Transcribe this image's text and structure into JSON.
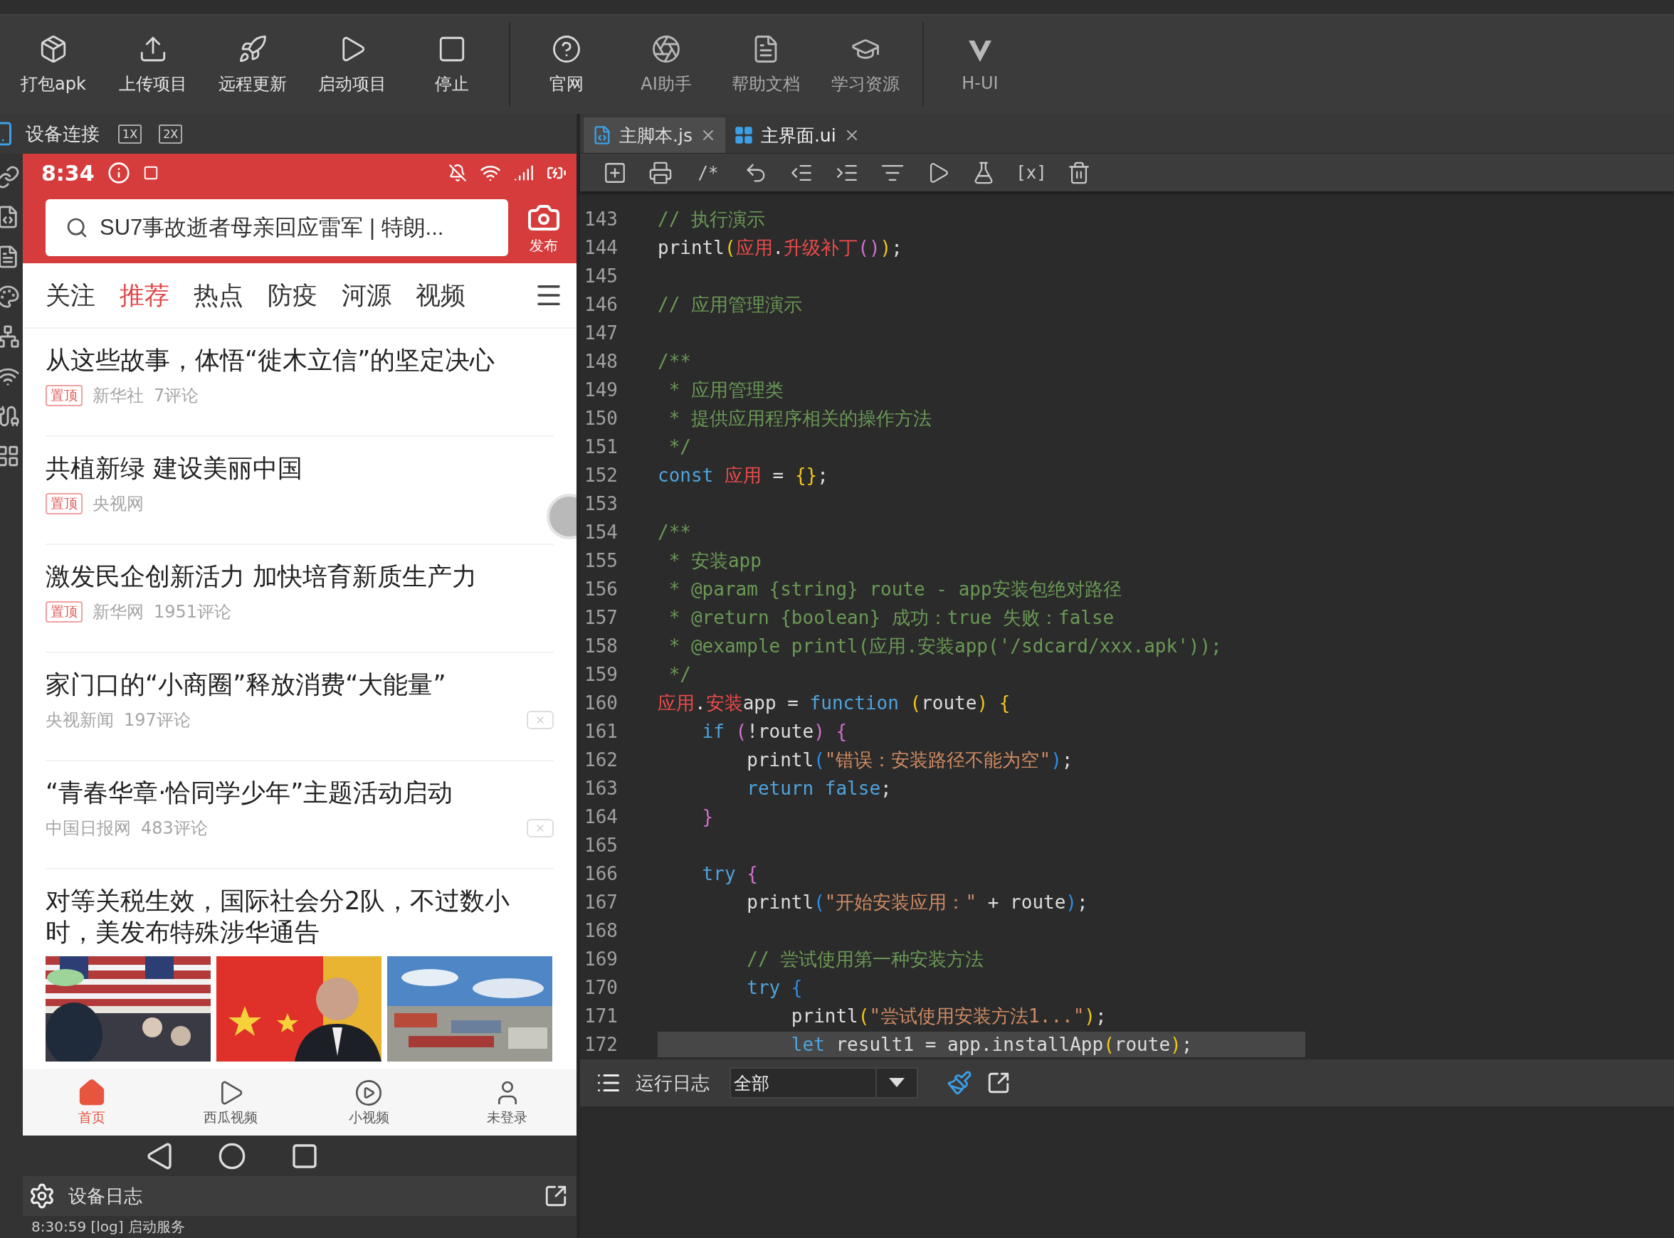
{
  "toolbar": {
    "groups": [
      {
        "items": [
          {
            "label": "打包apk",
            "disabled": false
          },
          {
            "label": "上传项目",
            "disabled": false
          },
          {
            "label": "远程更新",
            "disabled": false
          },
          {
            "label": "启动项目",
            "disabled": false
          },
          {
            "label": "停止",
            "disabled": false
          }
        ]
      },
      {
        "items": [
          {
            "label": "官网",
            "disabled": false
          },
          {
            "label": "AI助手",
            "disabled": true
          },
          {
            "label": "帮助文档",
            "disabled": true
          },
          {
            "label": "学习资源",
            "disabled": true
          }
        ]
      },
      {
        "items": [
          {
            "label": "H-UI",
            "disabled": true
          }
        ]
      }
    ]
  },
  "device_panel": {
    "title": "设备连接",
    "zoom_buttons": [
      "1X",
      "2X"
    ]
  },
  "phone": {
    "status_bar": {
      "time": "8:34"
    },
    "search": {
      "placeholder": "SU7事故逝者母亲回应雷军 | 特朗..."
    },
    "publish_label": "发布",
    "tabs": [
      {
        "label": "关注",
        "selected": false
      },
      {
        "label": "推荐",
        "selected": true
      },
      {
        "label": "热点",
        "selected": false
      },
      {
        "label": "防疫",
        "selected": false
      },
      {
        "label": "河源",
        "selected": false
      },
      {
        "label": "视频",
        "selected": false
      }
    ],
    "news": [
      {
        "title": "从这些故事，体悟“徙木立信”的坚定决心",
        "tag": "置顶",
        "source": "新华社",
        "comments": "7评论",
        "dismissible": false
      },
      {
        "title": "共植新绿 建设美丽中国",
        "tag": "置顶",
        "source": "央视网",
        "dismissible": false
      },
      {
        "title": "激发民企创新活力 加快培育新质生产力",
        "tag": "置顶",
        "source": "新华网",
        "comments": "1951评论",
        "dismissible": false
      },
      {
        "title": "家门口的“小商圈”释放消费“大能量”",
        "source": "央视新闻",
        "comments": "197评论",
        "dismissible": true
      },
      {
        "title": "“青春华章·恰同学少年”主题活动启动",
        "source": "中国日报网",
        "comments": "483评论",
        "dismissible": true
      },
      {
        "title": "对等关税生效，国际社会分2队，不过数小时，美发布特殊涉华通告",
        "dismissible": false
      }
    ],
    "bottom_nav": [
      {
        "label": "首页",
        "selected": true
      },
      {
        "label": "西瓜视频",
        "selected": false
      },
      {
        "label": "小视频",
        "selected": false
      },
      {
        "label": "未登录",
        "selected": false
      }
    ]
  },
  "device_log": {
    "title": "设备日志",
    "lines": [
      "8:30:59 [log] 启动服务"
    ]
  },
  "editor": {
    "tabs": [
      {
        "label": "主脚本.js",
        "kind": "js",
        "selected": true
      },
      {
        "label": "主界面.ui",
        "kind": "ui",
        "selected": false
      }
    ],
    "toolbar": [
      {
        "kind": "add"
      },
      {
        "kind": "print"
      },
      {
        "kind": "glyph",
        "text": "/*"
      },
      {
        "kind": "undo"
      },
      {
        "kind": "outdent"
      },
      {
        "kind": "indent"
      },
      {
        "kind": "format"
      },
      {
        "kind": "run"
      },
      {
        "kind": "test"
      },
      {
        "kind": "glyph",
        "text": "[x]"
      },
      {
        "kind": "clear"
      }
    ],
    "lines": [
      {
        "number": "143",
        "current": false,
        "tokens": [
          {
            "kind": "comment",
            "text": "// 执行演示"
          }
        ]
      },
      {
        "number": "144",
        "current": false,
        "tokens": [
          {
            "kind": "plain",
            "text": "printl"
          },
          {
            "kind": "paren1",
            "text": "("
          },
          {
            "kind": "ident",
            "text": "应用"
          },
          {
            "kind": "plain",
            "text": "."
          },
          {
            "kind": "ident",
            "text": "升级补丁"
          },
          {
            "kind": "paren2",
            "text": "()"
          },
          {
            "kind": "paren1",
            "text": ")"
          },
          {
            "kind": "plain",
            "text": ";"
          }
        ]
      },
      {
        "number": "145",
        "current": false
      },
      {
        "number": "146",
        "current": false,
        "tokens": [
          {
            "kind": "comment",
            "text": "// 应用管理演示"
          }
        ]
      },
      {
        "number": "147",
        "current": false
      },
      {
        "number": "148",
        "current": false,
        "tokens": [
          {
            "kind": "comment",
            "text": "/**"
          }
        ]
      },
      {
        "number": "149",
        "current": false,
        "tokens": [
          {
            "kind": "comment",
            "text": " * 应用管理类"
          }
        ]
      },
      {
        "number": "150",
        "current": false,
        "tokens": [
          {
            "kind": "comment",
            "text": " * 提供应用程序相关的操作方法"
          }
        ]
      },
      {
        "number": "151",
        "current": false,
        "tokens": [
          {
            "kind": "comment",
            "text": " */"
          }
        ]
      },
      {
        "number": "152",
        "current": false,
        "tokens": [
          {
            "kind": "keyword",
            "text": "const"
          },
          {
            "kind": "ident",
            "text": " 应用"
          },
          {
            "kind": "plain",
            "text": " = "
          },
          {
            "kind": "paren1",
            "text": "{}"
          },
          {
            "kind": "plain",
            "text": ";"
          }
        ]
      },
      {
        "number": "153",
        "current": false
      },
      {
        "number": "154",
        "current": false,
        "tokens": [
          {
            "kind": "comment",
            "text": "/**"
          }
        ]
      },
      {
        "number": "155",
        "current": false,
        "tokens": [
          {
            "kind": "comment",
            "text": " * 安装app"
          }
        ]
      },
      {
        "number": "156",
        "current": false,
        "tokens": [
          {
            "kind": "comment",
            "text": " * @param {string} route - app安装包绝对路径"
          }
        ]
      },
      {
        "number": "157",
        "current": false,
        "tokens": [
          {
            "kind": "comment",
            "text": " * @return {boolean} 成功：true 失败：false"
          }
        ]
      },
      {
        "number": "158",
        "current": false,
        "tokens": [
          {
            "kind": "comment",
            "text": " * @example printl(应用.安装app('/sdcard/xxx.apk'));"
          }
        ]
      },
      {
        "number": "159",
        "current": false,
        "tokens": [
          {
            "kind": "comment",
            "text": " */"
          }
        ]
      },
      {
        "number": "160",
        "current": false,
        "tokens": [
          {
            "kind": "ident",
            "text": "应用"
          },
          {
            "kind": "plain",
            "text": "."
          },
          {
            "kind": "ident",
            "text": "安装"
          },
          {
            "kind": "plain",
            "text": "app = "
          },
          {
            "kind": "keyword",
            "text": "function"
          },
          {
            "kind": "paren1",
            "text": " ("
          },
          {
            "kind": "plain",
            "text": "route"
          },
          {
            "kind": "paren1",
            "text": ")"
          },
          {
            "kind": "paren1",
            "text": " {"
          }
        ]
      },
      {
        "number": "161",
        "current": false,
        "tokens": [
          {
            "kind": "keyword",
            "text": "    if"
          },
          {
            "kind": "paren2",
            "text": " ("
          },
          {
            "kind": "plain",
            "text": "!route"
          },
          {
            "kind": "paren2",
            "text": ")"
          },
          {
            "kind": "paren2",
            "text": " {"
          }
        ]
      },
      {
        "number": "162",
        "current": false,
        "tokens": [
          {
            "kind": "plain",
            "text": "        printl"
          },
          {
            "kind": "paren3",
            "text": "("
          },
          {
            "kind": "string",
            "text": "\"错误：安装路径不能为空\""
          },
          {
            "kind": "paren3",
            "text": ")"
          },
          {
            "kind": "plain",
            "text": ";"
          }
        ]
      },
      {
        "number": "163",
        "current": false,
        "tokens": [
          {
            "kind": "keyword",
            "text": "        return"
          },
          {
            "kind": "keyword",
            "text": " false"
          },
          {
            "kind": "plain",
            "text": ";"
          }
        ]
      },
      {
        "number": "164",
        "current": false,
        "tokens": [
          {
            "kind": "paren2",
            "text": "    }"
          }
        ]
      },
      {
        "number": "165",
        "current": false
      },
      {
        "number": "166",
        "current": false,
        "tokens": [
          {
            "kind": "keyword",
            "text": "    try"
          },
          {
            "kind": "paren2",
            "text": " {"
          }
        ]
      },
      {
        "number": "167",
        "current": false,
        "tokens": [
          {
            "kind": "plain",
            "text": "        printl"
          },
          {
            "kind": "paren3",
            "text": "("
          },
          {
            "kind": "string",
            "text": "\"开始安装应用：\""
          },
          {
            "kind": "plain",
            "text": " + route"
          },
          {
            "kind": "paren3",
            "text": ")"
          },
          {
            "kind": "plain",
            "text": ";"
          }
        ]
      },
      {
        "number": "168",
        "current": false
      },
      {
        "number": "169",
        "current": false,
        "tokens": [
          {
            "kind": "comment",
            "text": "        // 尝试使用第一种安装方法"
          }
        ]
      },
      {
        "number": "170",
        "current": false,
        "tokens": [
          {
            "kind": "keyword",
            "text": "        try"
          },
          {
            "kind": "paren3",
            "text": " {"
          }
        ]
      },
      {
        "number": "171",
        "current": false,
        "tokens": [
          {
            "kind": "plain",
            "text": "            printl"
          },
          {
            "kind": "paren1",
            "text": "("
          },
          {
            "kind": "string",
            "text": "\"尝试使用安装方法1...\""
          },
          {
            "kind": "paren1",
            "text": ")"
          },
          {
            "kind": "plain",
            "text": ";"
          }
        ]
      },
      {
        "number": "172",
        "current": true,
        "tokens": [
          {
            "kind": "keyword",
            "text": "            let"
          },
          {
            "kind": "plain",
            "text": " result1 = app.installApp"
          },
          {
            "kind": "paren1",
            "text": "("
          },
          {
            "kind": "plain",
            "text": "route"
          },
          {
            "kind": "paren1",
            "text": ")"
          },
          {
            "kind": "plain",
            "text": ";"
          }
        ]
      }
    ]
  },
  "run_log": {
    "title": "运行日志",
    "filter": "全部"
  }
}
